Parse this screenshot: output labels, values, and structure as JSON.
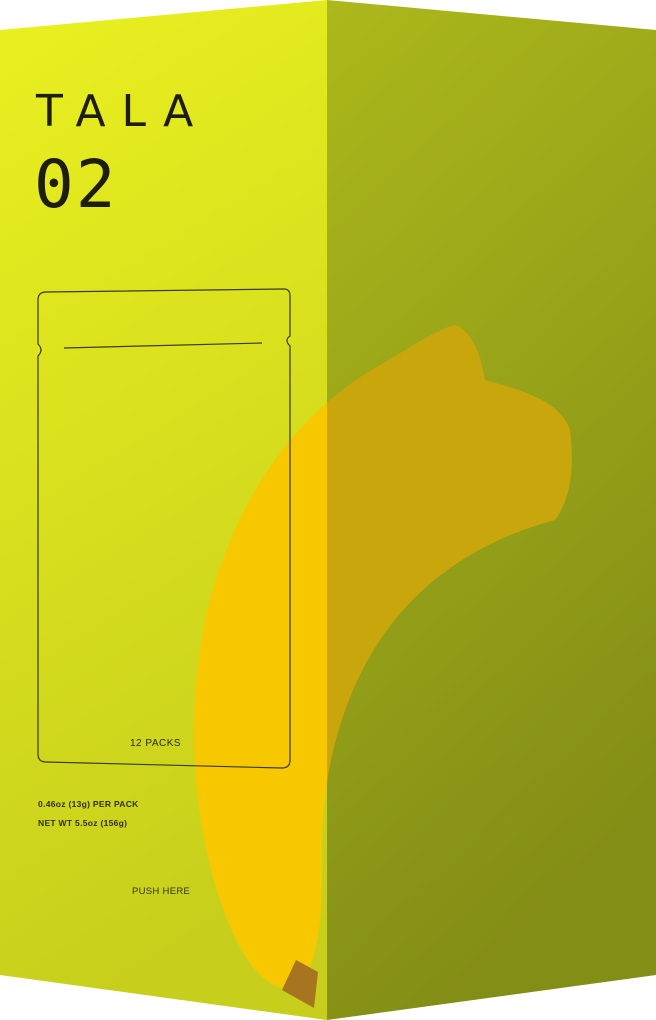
{
  "product": {
    "brand": "TALA",
    "number": "02",
    "packs_label": "12 PACKS",
    "per_pack": "0.46oz (13g) PER PACK",
    "net_weight": "NET WT 5.5oz (156g)",
    "push_label": "PUSH HERE"
  },
  "colors": {
    "front_face_top": "#e9ef1e",
    "front_face_bottom": "#c8d11c",
    "side_face_top": "#a9b51a",
    "side_face_bottom": "#869017",
    "banana": "#f7c600",
    "banana_shadow": "#b8a010",
    "banana_stem": "#a5711f",
    "outline": "#3a3a1c"
  },
  "icons": {
    "pouch": "pouch-outline-icon",
    "banana": "banana-illustration"
  }
}
